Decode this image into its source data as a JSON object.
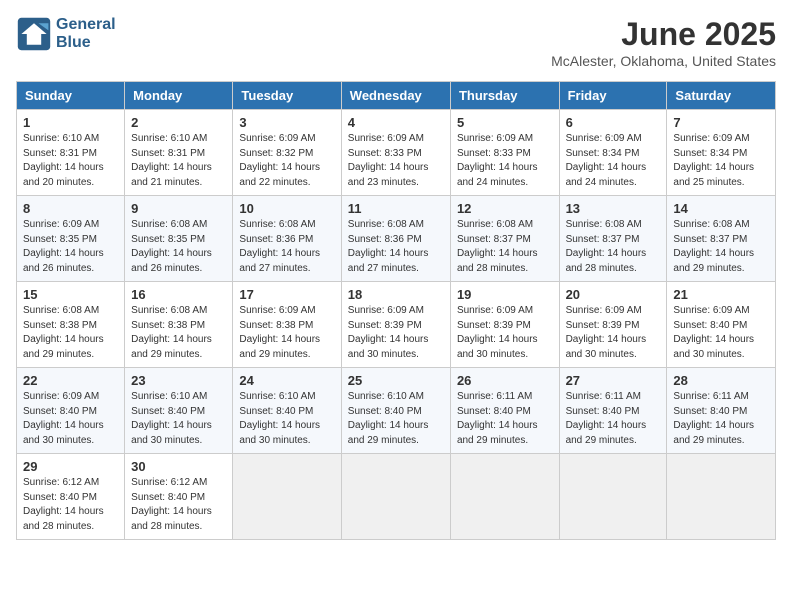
{
  "header": {
    "logo_line1": "General",
    "logo_line2": "Blue",
    "month": "June 2025",
    "location": "McAlester, Oklahoma, United States"
  },
  "weekdays": [
    "Sunday",
    "Monday",
    "Tuesday",
    "Wednesday",
    "Thursday",
    "Friday",
    "Saturday"
  ],
  "weeks": [
    [
      {
        "day": "1",
        "info": "Sunrise: 6:10 AM\nSunset: 8:31 PM\nDaylight: 14 hours\nand 20 minutes."
      },
      {
        "day": "2",
        "info": "Sunrise: 6:10 AM\nSunset: 8:31 PM\nDaylight: 14 hours\nand 21 minutes."
      },
      {
        "day": "3",
        "info": "Sunrise: 6:09 AM\nSunset: 8:32 PM\nDaylight: 14 hours\nand 22 minutes."
      },
      {
        "day": "4",
        "info": "Sunrise: 6:09 AM\nSunset: 8:33 PM\nDaylight: 14 hours\nand 23 minutes."
      },
      {
        "day": "5",
        "info": "Sunrise: 6:09 AM\nSunset: 8:33 PM\nDaylight: 14 hours\nand 24 minutes."
      },
      {
        "day": "6",
        "info": "Sunrise: 6:09 AM\nSunset: 8:34 PM\nDaylight: 14 hours\nand 24 minutes."
      },
      {
        "day": "7",
        "info": "Sunrise: 6:09 AM\nSunset: 8:34 PM\nDaylight: 14 hours\nand 25 minutes."
      }
    ],
    [
      {
        "day": "8",
        "info": "Sunrise: 6:09 AM\nSunset: 8:35 PM\nDaylight: 14 hours\nand 26 minutes."
      },
      {
        "day": "9",
        "info": "Sunrise: 6:08 AM\nSunset: 8:35 PM\nDaylight: 14 hours\nand 26 minutes."
      },
      {
        "day": "10",
        "info": "Sunrise: 6:08 AM\nSunset: 8:36 PM\nDaylight: 14 hours\nand 27 minutes."
      },
      {
        "day": "11",
        "info": "Sunrise: 6:08 AM\nSunset: 8:36 PM\nDaylight: 14 hours\nand 27 minutes."
      },
      {
        "day": "12",
        "info": "Sunrise: 6:08 AM\nSunset: 8:37 PM\nDaylight: 14 hours\nand 28 minutes."
      },
      {
        "day": "13",
        "info": "Sunrise: 6:08 AM\nSunset: 8:37 PM\nDaylight: 14 hours\nand 28 minutes."
      },
      {
        "day": "14",
        "info": "Sunrise: 6:08 AM\nSunset: 8:37 PM\nDaylight: 14 hours\nand 29 minutes."
      }
    ],
    [
      {
        "day": "15",
        "info": "Sunrise: 6:08 AM\nSunset: 8:38 PM\nDaylight: 14 hours\nand 29 minutes."
      },
      {
        "day": "16",
        "info": "Sunrise: 6:08 AM\nSunset: 8:38 PM\nDaylight: 14 hours\nand 29 minutes."
      },
      {
        "day": "17",
        "info": "Sunrise: 6:09 AM\nSunset: 8:38 PM\nDaylight: 14 hours\nand 29 minutes."
      },
      {
        "day": "18",
        "info": "Sunrise: 6:09 AM\nSunset: 8:39 PM\nDaylight: 14 hours\nand 30 minutes."
      },
      {
        "day": "19",
        "info": "Sunrise: 6:09 AM\nSunset: 8:39 PM\nDaylight: 14 hours\nand 30 minutes."
      },
      {
        "day": "20",
        "info": "Sunrise: 6:09 AM\nSunset: 8:39 PM\nDaylight: 14 hours\nand 30 minutes."
      },
      {
        "day": "21",
        "info": "Sunrise: 6:09 AM\nSunset: 8:40 PM\nDaylight: 14 hours\nand 30 minutes."
      }
    ],
    [
      {
        "day": "22",
        "info": "Sunrise: 6:09 AM\nSunset: 8:40 PM\nDaylight: 14 hours\nand 30 minutes."
      },
      {
        "day": "23",
        "info": "Sunrise: 6:10 AM\nSunset: 8:40 PM\nDaylight: 14 hours\nand 30 minutes."
      },
      {
        "day": "24",
        "info": "Sunrise: 6:10 AM\nSunset: 8:40 PM\nDaylight: 14 hours\nand 30 minutes."
      },
      {
        "day": "25",
        "info": "Sunrise: 6:10 AM\nSunset: 8:40 PM\nDaylight: 14 hours\nand 29 minutes."
      },
      {
        "day": "26",
        "info": "Sunrise: 6:11 AM\nSunset: 8:40 PM\nDaylight: 14 hours\nand 29 minutes."
      },
      {
        "day": "27",
        "info": "Sunrise: 6:11 AM\nSunset: 8:40 PM\nDaylight: 14 hours\nand 29 minutes."
      },
      {
        "day": "28",
        "info": "Sunrise: 6:11 AM\nSunset: 8:40 PM\nDaylight: 14 hours\nand 29 minutes."
      }
    ],
    [
      {
        "day": "29",
        "info": "Sunrise: 6:12 AM\nSunset: 8:40 PM\nDaylight: 14 hours\nand 28 minutes."
      },
      {
        "day": "30",
        "info": "Sunrise: 6:12 AM\nSunset: 8:40 PM\nDaylight: 14 hours\nand 28 minutes."
      },
      null,
      null,
      null,
      null,
      null
    ]
  ]
}
